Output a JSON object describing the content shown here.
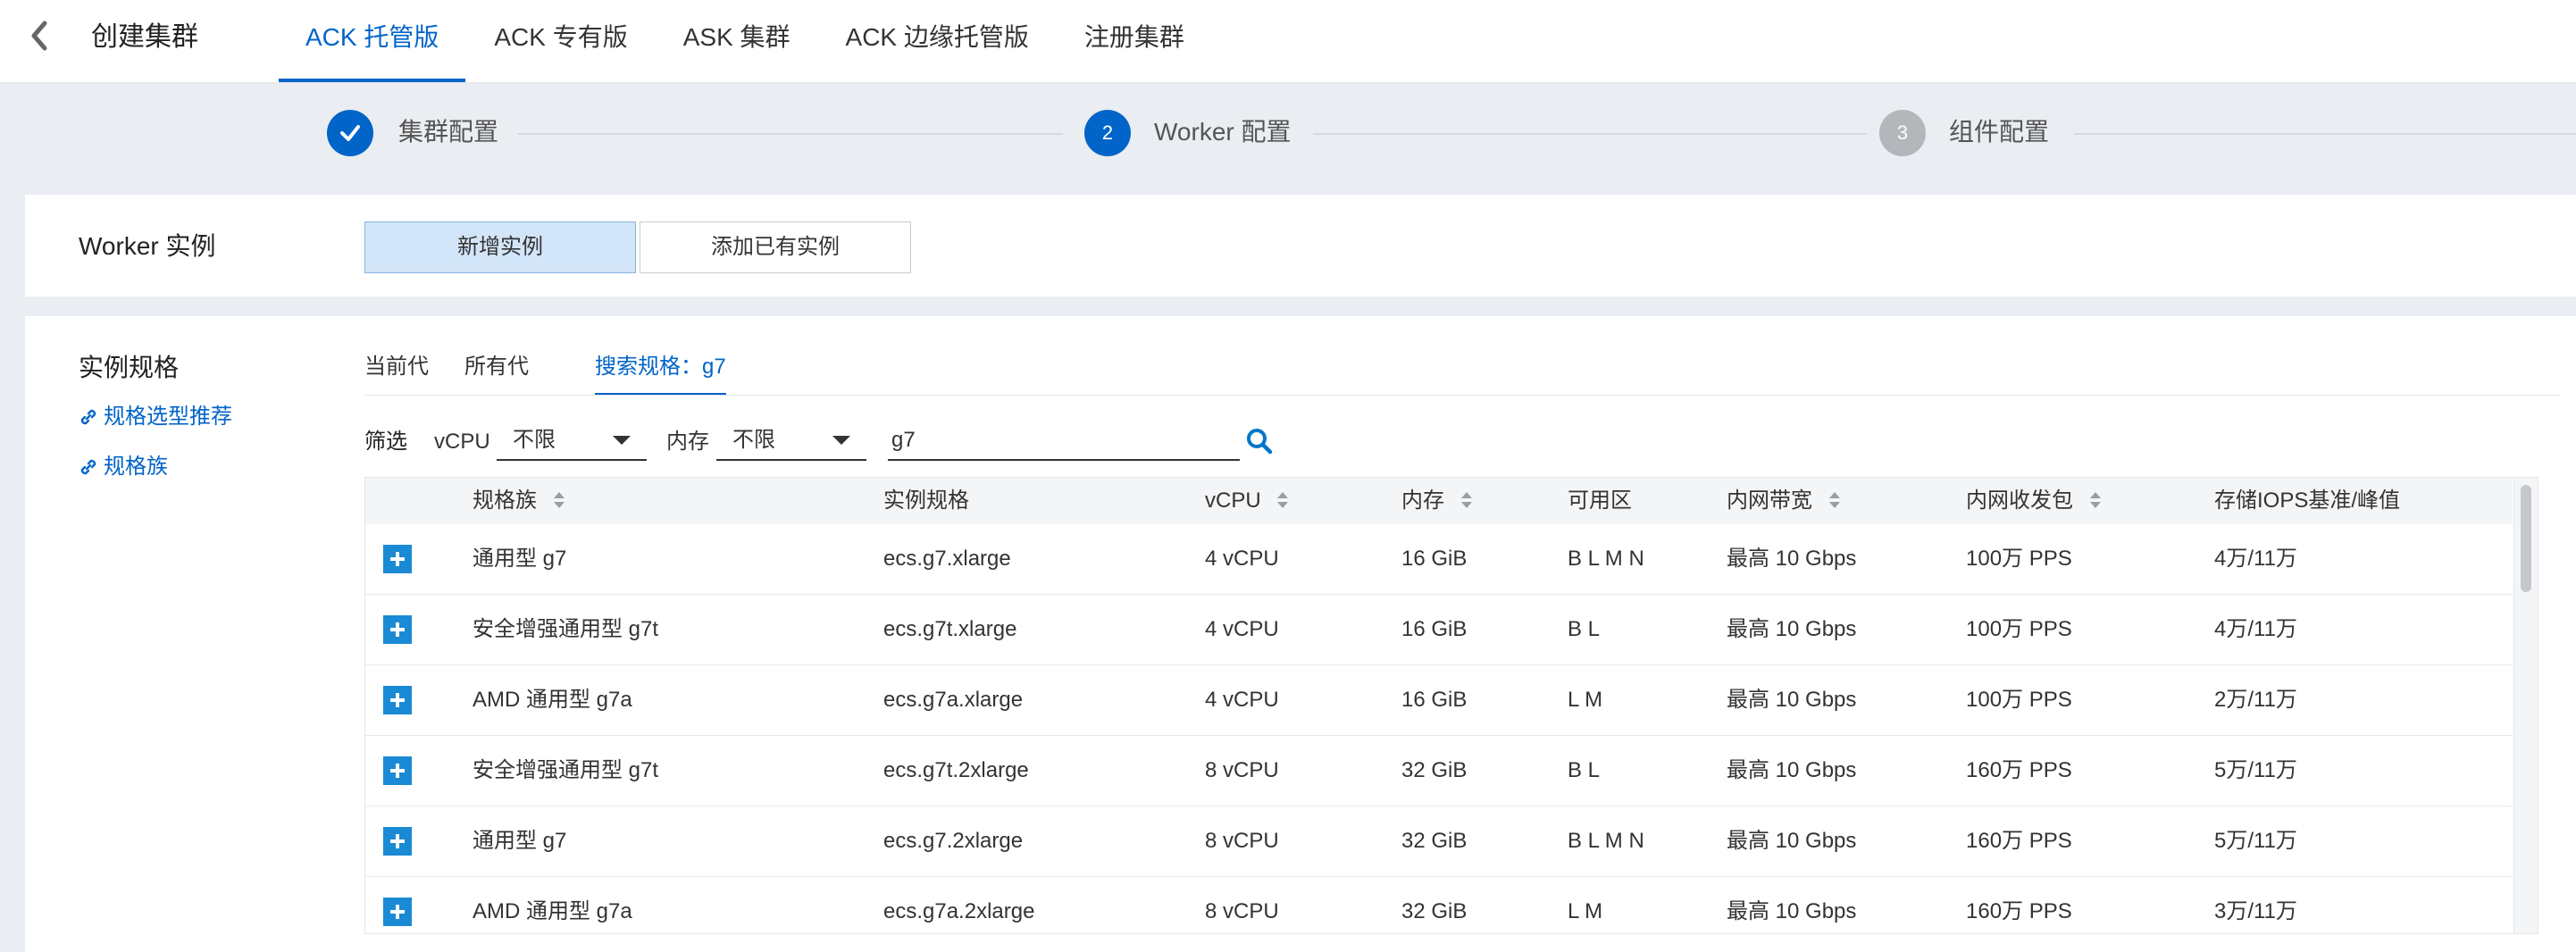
{
  "header": {
    "title": "创建集群",
    "tabs": [
      {
        "label": "ACK 托管版",
        "active": true
      },
      {
        "label": "ACK 专有版",
        "active": false
      },
      {
        "label": "ASK 集群",
        "active": false
      },
      {
        "label": "ACK 边缘托管版",
        "active": false
      },
      {
        "label": "注册集群",
        "active": false
      }
    ]
  },
  "steps": [
    {
      "number": "1",
      "label": "集群配置",
      "status": "done"
    },
    {
      "number": "2",
      "label": "Worker 配置",
      "status": "current"
    },
    {
      "number": "3",
      "label": "组件配置",
      "status": "pending"
    }
  ],
  "worker_instance": {
    "label": "Worker 实例",
    "new_label": "新增实例",
    "add_existing_label": "添加已有实例"
  },
  "instance_spec": {
    "label": "实例规格",
    "links": [
      "规格选型推荐",
      "规格族"
    ],
    "gen_tabs": [
      {
        "label": "当前代",
        "active": false
      },
      {
        "label": "所有代",
        "active": false
      },
      {
        "label": "搜索规格：g7",
        "active": true
      }
    ],
    "filter": {
      "label": "筛选",
      "vcpu_label": "vCPU",
      "vcpu_value": "不限",
      "mem_label": "内存",
      "mem_value": "不限",
      "search_value": "g7"
    },
    "columns": [
      "规格族",
      "实例规格",
      "vCPU",
      "内存",
      "可用区",
      "内网带宽",
      "内网收发包",
      "存储IOPS基准/峰值"
    ],
    "rows": [
      [
        "通用型 g7",
        "ecs.g7.xlarge",
        "4 vCPU",
        "16 GiB",
        "B L M N",
        "最高 10 Gbps",
        "100万 PPS",
        "4万/11万"
      ],
      [
        "安全增强通用型 g7t",
        "ecs.g7t.xlarge",
        "4 vCPU",
        "16 GiB",
        "B L",
        "最高 10 Gbps",
        "100万 PPS",
        "4万/11万"
      ],
      [
        "AMD 通用型 g7a",
        "ecs.g7a.xlarge",
        "4 vCPU",
        "16 GiB",
        "L M",
        "最高 10 Gbps",
        "100万 PPS",
        "2万/11万"
      ],
      [
        "安全增强通用型 g7t",
        "ecs.g7t.2xlarge",
        "8 vCPU",
        "32 GiB",
        "B L",
        "最高 10 Gbps",
        "160万 PPS",
        "5万/11万"
      ],
      [
        "通用型 g7",
        "ecs.g7.2xlarge",
        "8 vCPU",
        "32 GiB",
        "B L M N",
        "最高 10 Gbps",
        "160万 PPS",
        "5万/11万"
      ],
      [
        "AMD 通用型 g7a",
        "ecs.g7a.2xlarge",
        "8 vCPU",
        "32 GiB",
        "L M",
        "最高 10 Gbps",
        "160万 PPS",
        "3万/11万"
      ]
    ]
  },
  "colors": {
    "accent": "#0064c8",
    "step_done": "#0064c8",
    "step_pending": "#b3b6ba",
    "expand": "#1a8ad4",
    "background": "#eaedf1"
  },
  "icons": [
    "back-chevron-icon",
    "check-icon",
    "link-icon",
    "sort-icon",
    "search-icon",
    "plus-icon"
  ]
}
